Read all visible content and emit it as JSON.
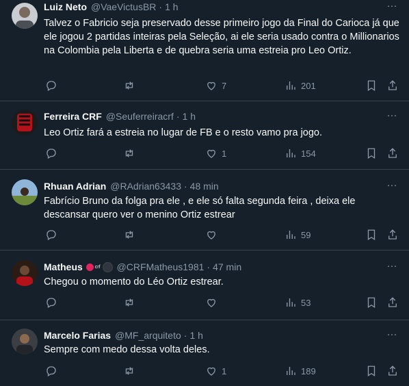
{
  "tweets": [
    {
      "name": "Luiz Neto",
      "handle": "@VaeVictusBR",
      "time": "1 h",
      "text": "Talvez o Fabricio seja preservado desse primeiro jogo da Final do Carioca já que ele jogou 2 partidas inteiras pela Seleção, ai ele seria usado contra o Millionarios na Colombia pela Liberta e de quebra seria uma estreia pro Leo Ortiz.",
      "likes": "7",
      "views": "201"
    },
    {
      "name": "Ferreira CRF",
      "handle": "@Seuferreiracrf",
      "time": "1 h",
      "text": "Leo Ortiz fará a estreia no lugar de FB e o resto vamo pra jogo.",
      "likes": "1",
      "views": "154"
    },
    {
      "name": "Rhuan Adrian",
      "handle": "@RAdrian63433",
      "time": "48 min",
      "text": "Fabrício Bruno da folga pra ele , e ele só falta segunda feira , deixa ele descansar quero ver o menino Ortiz estrear",
      "likes": "",
      "views": "59"
    },
    {
      "name": "Matheus",
      "badge_text": "crf",
      "handle": "@CRFMatheus1981",
      "time": "47 min",
      "text": "Chegou o momento do Léo Ortiz estrear.",
      "likes": "",
      "views": "53"
    },
    {
      "name": "Marcelo Farias",
      "handle": "@MF_arquiteto",
      "time": "1 h",
      "text": "Sempre com medo dessa volta deles.",
      "likes": "1",
      "views": "189"
    }
  ],
  "separator": "·",
  "more_glyph": "···",
  "colors": {
    "background": "#15202b",
    "text": "#f7f9f9",
    "muted": "#8b98a5",
    "divider": "#38444d"
  }
}
